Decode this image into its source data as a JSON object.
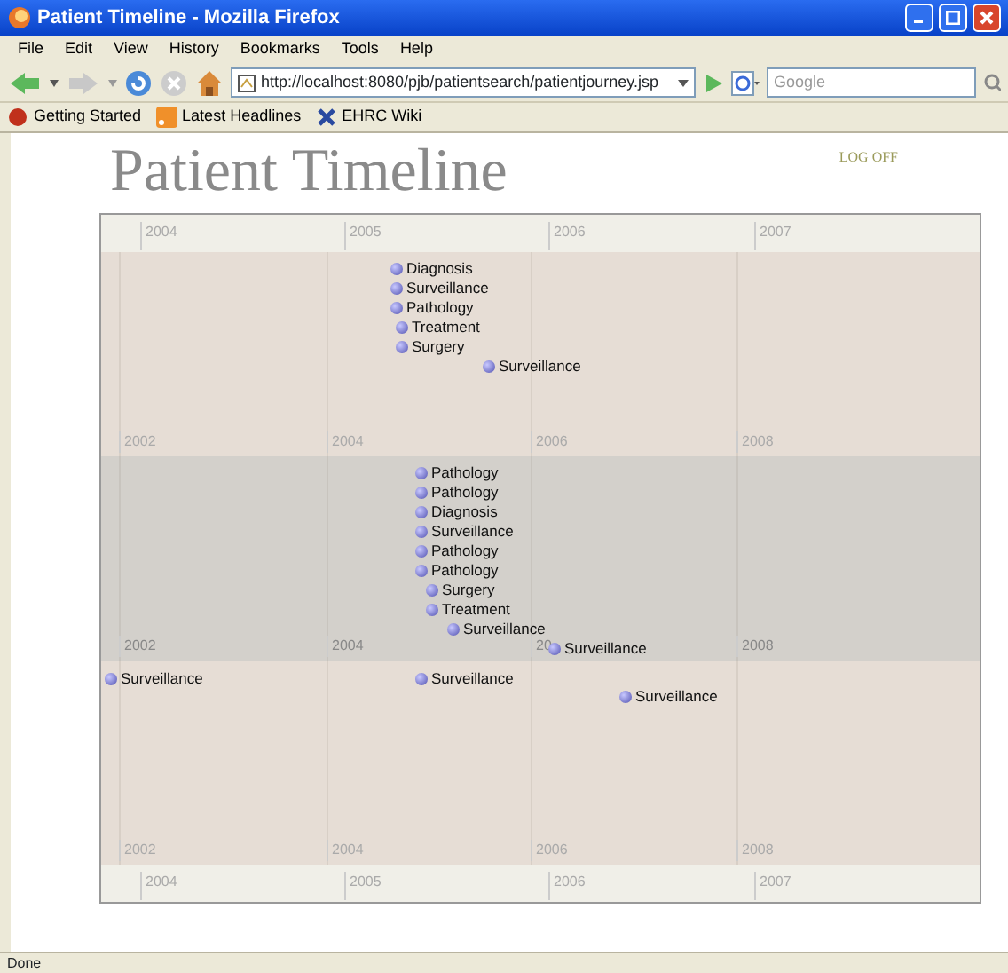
{
  "window": {
    "title": "Patient Timeline - Mozilla Firefox"
  },
  "menu": [
    "File",
    "Edit",
    "View",
    "History",
    "Bookmarks",
    "Tools",
    "Help"
  ],
  "address_bar": {
    "value": "http://localhost:8080/pjb/patientsearch/patientjourney.jsp"
  },
  "search": {
    "placeholder": "Google"
  },
  "bookmarks": [
    "Getting Started",
    "Latest Headlines",
    "EHRC Wiki"
  ],
  "page": {
    "title": "Patient Timeline",
    "log_off": "LOG OFF"
  },
  "timeline": {
    "top_scale": [
      "2004",
      "2005",
      "2006",
      "2007"
    ],
    "bands": [
      {
        "highlighted": false,
        "years": [
          "2002",
          "2004",
          "2006",
          "2008"
        ],
        "events": [
          {
            "label": "Diagnosis"
          },
          {
            "label": "Surveillance"
          },
          {
            "label": "Pathology"
          },
          {
            "label": "Treatment"
          },
          {
            "label": "Surgery"
          },
          {
            "label": "Surveillance"
          }
        ]
      },
      {
        "highlighted": true,
        "years": [
          "2002",
          "2004",
          "20",
          "2008"
        ],
        "events": [
          {
            "label": "Pathology"
          },
          {
            "label": "Pathology"
          },
          {
            "label": "Diagnosis"
          },
          {
            "label": "Surveillance"
          },
          {
            "label": "Pathology"
          },
          {
            "label": "Pathology"
          },
          {
            "label": "Surgery"
          },
          {
            "label": "Treatment"
          },
          {
            "label": "Surveillance"
          },
          {
            "label": "Surveillance"
          }
        ]
      },
      {
        "highlighted": false,
        "years": [
          "2002",
          "2004",
          "2006",
          "2008"
        ],
        "events": [
          {
            "label": "Surveillance"
          },
          {
            "label": "Surveillance"
          },
          {
            "label": "Surveillance"
          }
        ]
      }
    ],
    "bottom_scale": [
      "2004",
      "2005",
      "2006",
      "2007"
    ]
  },
  "status_bar": "Done"
}
